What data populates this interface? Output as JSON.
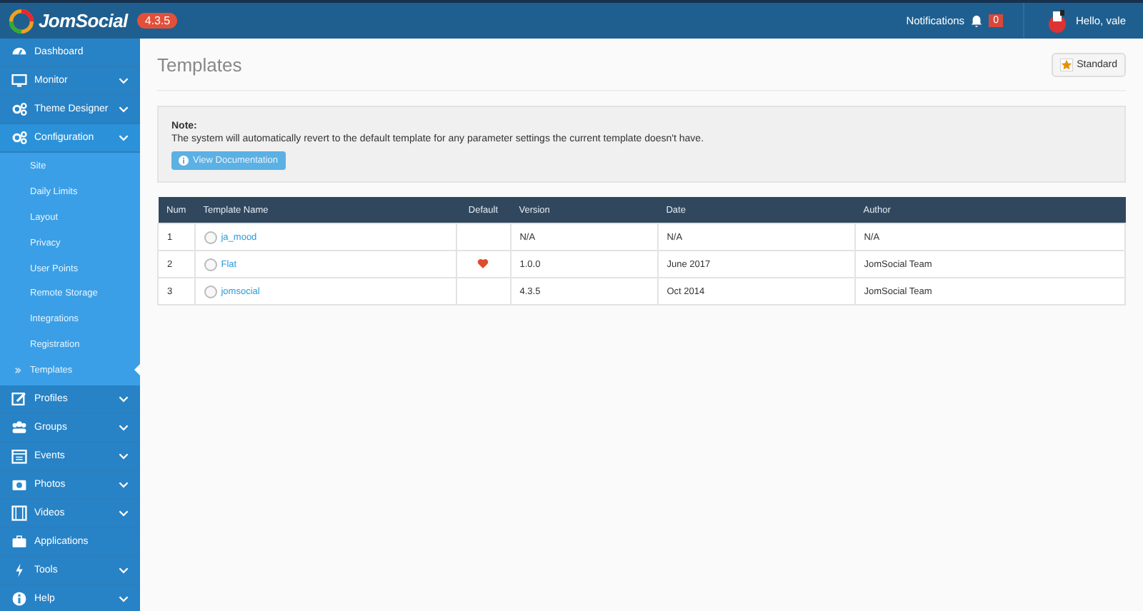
{
  "header": {
    "brand": "JomSocial",
    "version": "4.3.5",
    "notifications_label": "Notifications",
    "notifications_count": "0",
    "greeting": "Hello, vale"
  },
  "sidebar": {
    "items": [
      {
        "label": "Dashboard",
        "kind": "link",
        "expanded": false
      },
      {
        "label": "Monitor",
        "kind": "menu",
        "expanded": false
      },
      {
        "label": "Theme Designer",
        "kind": "menu",
        "expanded": false
      },
      {
        "label": "Configuration",
        "kind": "menu",
        "expanded": true,
        "children": [
          {
            "label": "Site",
            "selected": false
          },
          {
            "label": "Daily Limits",
            "selected": false
          },
          {
            "label": "Layout",
            "selected": false
          },
          {
            "label": "Privacy",
            "selected": false
          },
          {
            "label": "User Points",
            "selected": false
          },
          {
            "label": "Remote Storage",
            "selected": false
          },
          {
            "label": "Integrations",
            "selected": false
          },
          {
            "label": "Registration",
            "selected": false
          },
          {
            "label": "Templates",
            "selected": true
          }
        ]
      },
      {
        "label": "Profiles",
        "kind": "menu",
        "expanded": false
      },
      {
        "label": "Groups",
        "kind": "menu",
        "expanded": false
      },
      {
        "label": "Events",
        "kind": "menu",
        "expanded": false
      },
      {
        "label": "Photos",
        "kind": "menu",
        "expanded": false
      },
      {
        "label": "Videos",
        "kind": "menu",
        "expanded": false
      },
      {
        "label": "Applications",
        "kind": "link",
        "expanded": false
      },
      {
        "label": "Tools",
        "kind": "menu",
        "expanded": false
      },
      {
        "label": "Help",
        "kind": "menu",
        "expanded": false
      }
    ]
  },
  "page": {
    "title": "Templates",
    "standard_button": "Standard"
  },
  "note": {
    "heading": "Note:",
    "text": "The system will automatically revert to the default template for any parameter settings the current template doesn't have.",
    "button": "View Documentation"
  },
  "table": {
    "columns": [
      "Num",
      "Template Name",
      "Default",
      "Version",
      "Date",
      "Author"
    ],
    "rows": [
      {
        "num": "1",
        "name": "ja_mood",
        "selected": false,
        "default": false,
        "version": "N/A",
        "date": "N/A",
        "author": "N/A"
      },
      {
        "num": "2",
        "name": "Flat",
        "selected": false,
        "default": true,
        "version": "1.0.0",
        "date": "June 2017",
        "author": "JomSocial Team"
      },
      {
        "num": "3",
        "name": "jomsocial",
        "selected": false,
        "default": false,
        "version": "4.3.5",
        "date": "Oct 2014",
        "author": "JomSocial Team"
      }
    ]
  }
}
